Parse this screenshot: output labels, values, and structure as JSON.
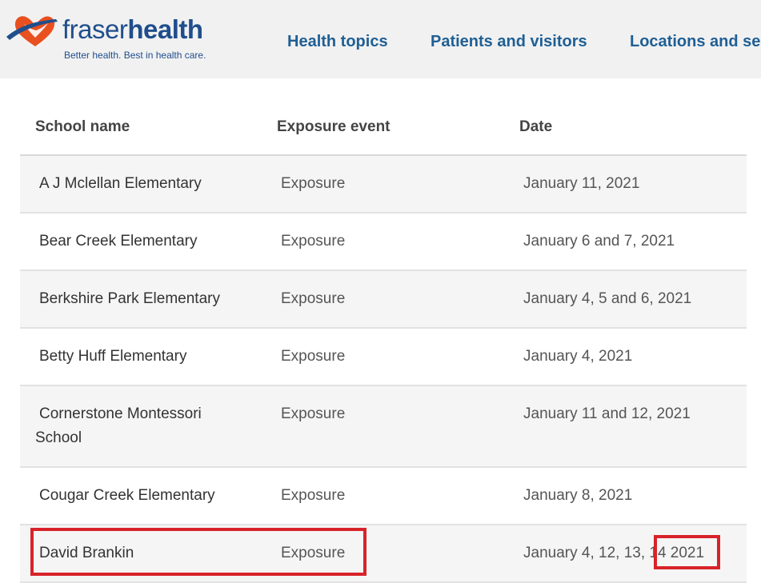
{
  "header": {
    "brand_light": "fraser",
    "brand_bold": "health",
    "tagline": "Better health. Best in health care.",
    "nav": [
      "Health topics",
      "Patients and visitors",
      "Locations and se"
    ]
  },
  "table": {
    "columns": [
      "School name",
      "Exposure event",
      "Date"
    ],
    "rows": [
      {
        "school": "A J Mclellan Elementary",
        "event": "Exposure",
        "date": "January 11, 2021"
      },
      {
        "school": "Bear Creek Elementary",
        "event": "Exposure",
        "date": "January 6 and 7, 2021"
      },
      {
        "school": "Berkshire Park Elementary",
        "event": "Exposure",
        "date": "January 4, 5 and 6, 2021"
      },
      {
        "school": "Betty Huff Elementary",
        "event": "Exposure",
        "date": "January 4, 2021"
      },
      {
        "school": "Cornerstone Montessori School",
        "event": "Exposure",
        "date": "January 11 and 12, 2021"
      },
      {
        "school": "Cougar Creek Elementary",
        "event": "Exposure",
        "date": "January 8, 2021"
      },
      {
        "school": "David Brankin",
        "event": "Exposure",
        "date": "January 4, 12, 13, 14 2021"
      }
    ]
  },
  "colors": {
    "brand_blue": "#1f4e8c",
    "nav_blue": "#1f5f94",
    "logo_orange": "#e8501f",
    "highlight_red": "#d8232a"
  }
}
